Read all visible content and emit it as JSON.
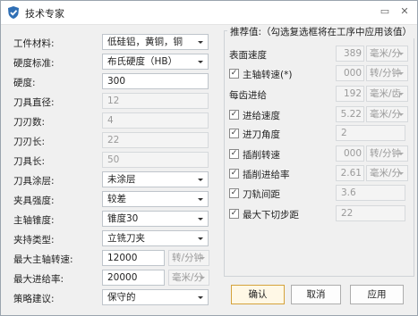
{
  "window": {
    "title": "技术专家",
    "icon": "shield-check-icon",
    "minimize_icon": "restore-icon",
    "close_icon": "close-icon"
  },
  "form": [
    {
      "label": "工件材料:",
      "value": "低硅铝，黄铜，铜",
      "type": "select",
      "enabled": true
    },
    {
      "label": "硬度标准:",
      "value": "布氏硬度（HB）",
      "type": "select",
      "enabled": true
    },
    {
      "label": "硬度:",
      "value": "300",
      "type": "input",
      "enabled": true
    },
    {
      "label": "刀具直径:",
      "value": "12",
      "type": "input",
      "enabled": false
    },
    {
      "label": "刀刃数:",
      "value": "4",
      "type": "input",
      "enabled": false
    },
    {
      "label": "刀刃长:",
      "value": "22",
      "type": "input",
      "enabled": false
    },
    {
      "label": "刀具长:",
      "value": "50",
      "type": "input",
      "enabled": false
    },
    {
      "label": "刀具涂层:",
      "value": "未涂层",
      "type": "select",
      "enabled": true
    },
    {
      "label": "夹具强度:",
      "value": "较差",
      "type": "select",
      "enabled": true
    },
    {
      "label": "主轴锥度:",
      "value": "锥度30",
      "type": "select",
      "enabled": true
    },
    {
      "label": "夹持类型:",
      "value": "立铣刀夹",
      "type": "select",
      "enabled": true
    },
    {
      "label": "最大主轴转速:",
      "value": "12000",
      "type": "input",
      "enabled": true,
      "unit": "转/分钟"
    },
    {
      "label": "最大进给率:",
      "value": "20000",
      "type": "input",
      "enabled": true,
      "unit": "毫米/分"
    },
    {
      "label": "策略建议:",
      "value": "保守的",
      "type": "select",
      "enabled": true
    }
  ],
  "recommend": {
    "title": "推荐值:（勾选复选框将在工序中应用该值）",
    "rows": [
      {
        "label": "表面速度",
        "checkbox": false,
        "value": "389",
        "unit": "毫米/分"
      },
      {
        "label": "主轴转速(*)",
        "checkbox": true,
        "checked": true,
        "value": "000",
        "unit": "转/分钟"
      },
      {
        "label": "每齿进给",
        "checkbox": false,
        "value": "192",
        "unit": "毫米/齿"
      },
      {
        "label": "进给速度",
        "checkbox": true,
        "checked": true,
        "value": "5.22",
        "unit": "毫米/分"
      },
      {
        "label": "进刀角度",
        "checkbox": true,
        "checked": true,
        "value": "2",
        "wide": true
      },
      {
        "label": "插削转速",
        "checkbox": true,
        "checked": true,
        "value": "000",
        "unit": "转/分钟"
      },
      {
        "label": "插削进给率",
        "checkbox": true,
        "checked": true,
        "value": "2.61",
        "unit": "毫米/分"
      },
      {
        "label": "刀轨间距",
        "checkbox": true,
        "checked": true,
        "value": "3.6",
        "wide": true
      },
      {
        "label": "最大下切步距",
        "checkbox": true,
        "checked": true,
        "value": "22",
        "wide": true
      }
    ]
  },
  "buttons": {
    "ok": "确认",
    "cancel": "取消",
    "apply": "应用"
  },
  "colors": {
    "accent_border": "#d5a23b",
    "window_bg": "#f0f0f0"
  }
}
